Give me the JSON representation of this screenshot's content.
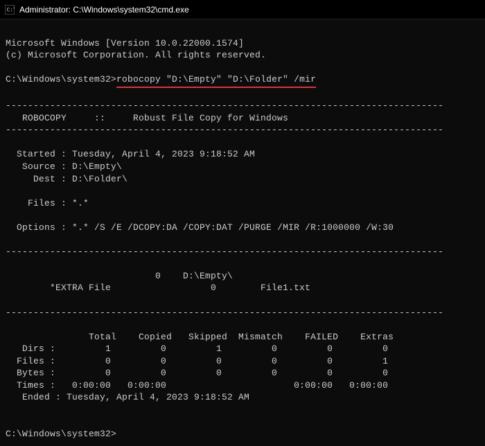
{
  "titlebar": {
    "icon_name": "cmd-icon",
    "text": "Administrator: C:\\Windows\\system32\\cmd.exe"
  },
  "header": {
    "line1": "Microsoft Windows [Version 10.0.22000.1574]",
    "line2": "(c) Microsoft Corporation. All rights reserved."
  },
  "prompt1": {
    "path": "C:\\Windows\\system32>",
    "command": "robocopy \"D:\\Empty\" \"D:\\Folder\" /mir"
  },
  "robocopy": {
    "divider": "-------------------------------------------------------------------------------",
    "banner": "   ROBOCOPY     ::     Robust File Copy for Windows                              ",
    "started_label": "  Started :",
    "started_value": " Tuesday, April 4, 2023 9:18:52 AM",
    "source_label": "   Source :",
    "source_value": " D:\\Empty\\",
    "dest_label": "     Dest :",
    "dest_value": " D:\\Folder\\",
    "files_label": "    Files :",
    "files_value": " *.*",
    "options_label": "  Options :",
    "options_value": " *.* /S /E /DCOPY:DA /COPY:DAT /PURGE /MIR /R:1000000 /W:30",
    "listing_line1": "                           0    D:\\Empty\\",
    "listing_line2": "        *EXTRA File                  0        File1.txt",
    "table": {
      "header": "               Total    Copied   Skipped  Mismatch    FAILED    Extras",
      "dirs": "   Dirs :         1         0         1         0         0         0",
      "files": "  Files :         0         0         0         0         0         1",
      "bytes": "  Bytes :         0         0         0         0         0         0",
      "times": "  Times :   0:00:00   0:00:00                       0:00:00   0:00:00"
    },
    "ended_label": "   Ended :",
    "ended_value": " Tuesday, April 4, 2023 9:18:52 AM"
  },
  "prompt2": {
    "path": "C:\\Windows\\system32>"
  }
}
